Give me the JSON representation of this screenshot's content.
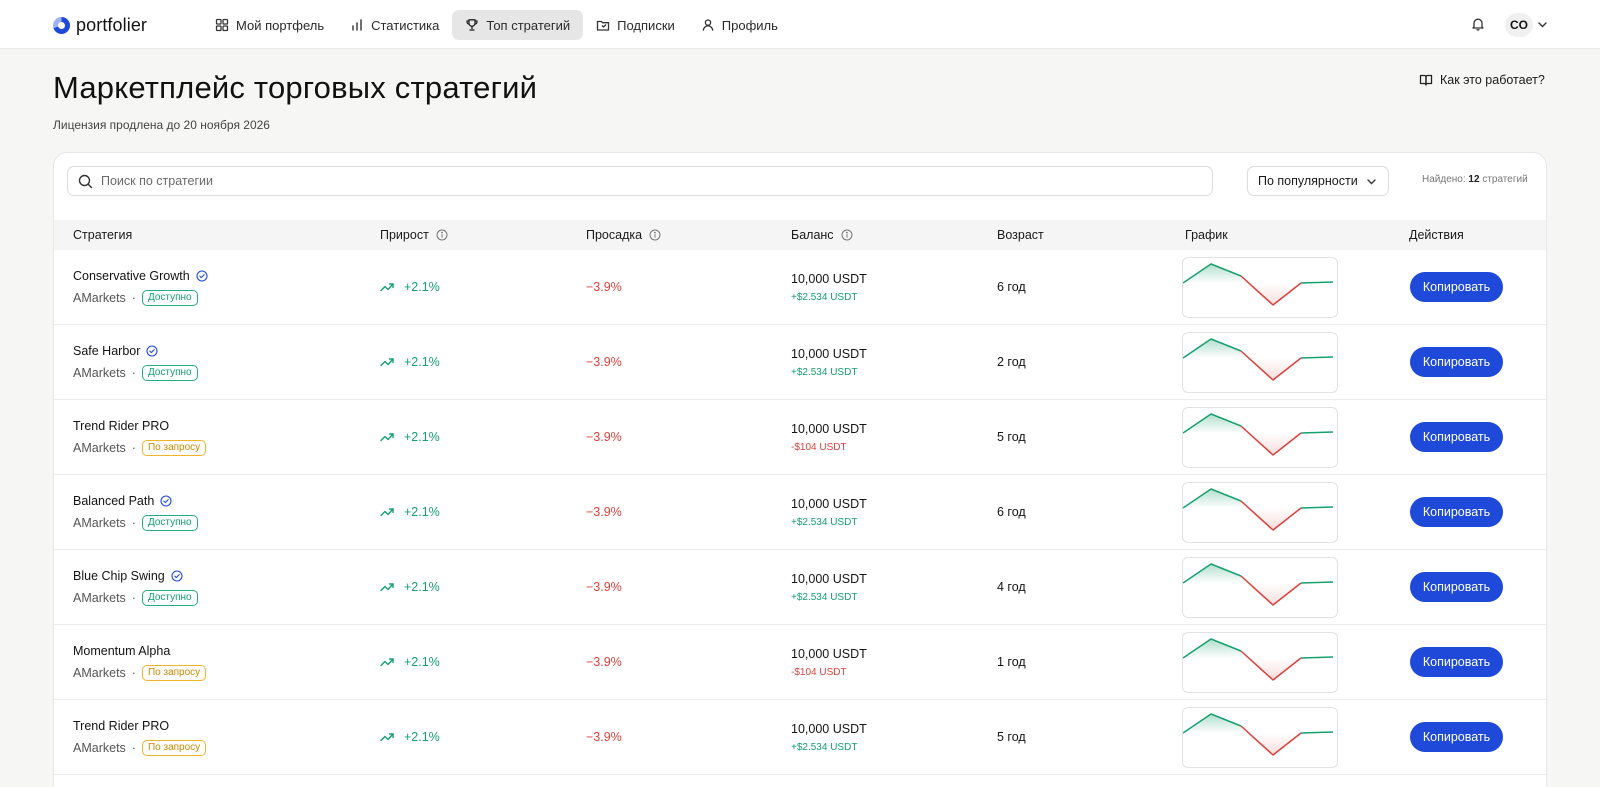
{
  "brand": {
    "name": "portfolier"
  },
  "nav": {
    "items": [
      {
        "label": "Мой портфель",
        "icon": "grid-icon",
        "active": false
      },
      {
        "label": "Статистика",
        "icon": "bar-chart-icon",
        "active": false
      },
      {
        "label": "Топ стратегий",
        "icon": "trophy-icon",
        "active": true
      },
      {
        "label": "Подписки",
        "icon": "folder-icon",
        "active": false
      },
      {
        "label": "Профиль",
        "icon": "user-icon",
        "active": false
      }
    ],
    "avatar_initials": "CO"
  },
  "header": {
    "title": "Маркетплейс торговых стратегий",
    "subtitle": "Лицензия продлена до 20 ноября 2026",
    "help_link": "Как это работает?"
  },
  "toolbar": {
    "search_placeholder": "Поиск по стратегии",
    "sort_label": "По популярности",
    "found_prefix": "Найдено:",
    "found_count": "12",
    "found_suffix": "стратегий"
  },
  "table": {
    "columns": {
      "strategy": "Стратегия",
      "growth": "Прирост",
      "drawdown": "Просадка",
      "balance": "Баланс",
      "age": "Возраст",
      "chart": "График",
      "actions": "Действия"
    },
    "copy_label": "Копировать",
    "rows": [
      {
        "name": "Conservative Growth",
        "verified": true,
        "broker": "AMarkets",
        "status": "Доступно",
        "status_kind": "ok",
        "growth": "+2.1%",
        "drawdown": "−3.9%",
        "balance": "10,000 USDT",
        "delta": "+$2.534 USDT",
        "delta_kind": "pos",
        "age": "6 год"
      },
      {
        "name": "Safe Harbor",
        "verified": true,
        "broker": "AMarkets",
        "status": "Доступно",
        "status_kind": "ok",
        "growth": "+2.1%",
        "drawdown": "−3.9%",
        "balance": "10,000 USDT",
        "delta": "+$2.534 USDT",
        "delta_kind": "pos",
        "age": "2 год"
      },
      {
        "name": "Trend Rider PRO",
        "verified": false,
        "broker": "AMarkets",
        "status": "По запросу",
        "status_kind": "req",
        "growth": "+2.1%",
        "drawdown": "−3.9%",
        "balance": "10,000 USDT",
        "delta": "-$104 USDT",
        "delta_kind": "neg",
        "age": "5 год"
      },
      {
        "name": "Balanced Path",
        "verified": true,
        "broker": "AMarkets",
        "status": "Доступно",
        "status_kind": "ok",
        "growth": "+2.1%",
        "drawdown": "−3.9%",
        "balance": "10,000 USDT",
        "delta": "+$2.534 USDT",
        "delta_kind": "pos",
        "age": "6 год"
      },
      {
        "name": "Blue Chip Swing",
        "verified": true,
        "broker": "AMarkets",
        "status": "Доступно",
        "status_kind": "ok",
        "growth": "+2.1%",
        "drawdown": "−3.9%",
        "balance": "10,000 USDT",
        "delta": "+$2.534 USDT",
        "delta_kind": "pos",
        "age": "4 год"
      },
      {
        "name": "Momentum Alpha",
        "verified": false,
        "broker": "AMarkets",
        "status": "По запросу",
        "status_kind": "req",
        "growth": "+2.1%",
        "drawdown": "−3.9%",
        "balance": "10,000 USDT",
        "delta": "-$104 USDT",
        "delta_kind": "neg",
        "age": "1 год"
      },
      {
        "name": "Trend Rider PRO",
        "verified": false,
        "broker": "AMarkets",
        "status": "По запросу",
        "status_kind": "req",
        "growth": "+2.1%",
        "drawdown": "−3.9%",
        "balance": "10,000 USDT",
        "delta": "+$2.534 USDT",
        "delta_kind": "pos",
        "age": "5 год"
      }
    ]
  },
  "colors": {
    "accent": "#1f49d8",
    "positive": "#16a06e",
    "negative": "#d9423d",
    "warning": "#efb52a"
  }
}
